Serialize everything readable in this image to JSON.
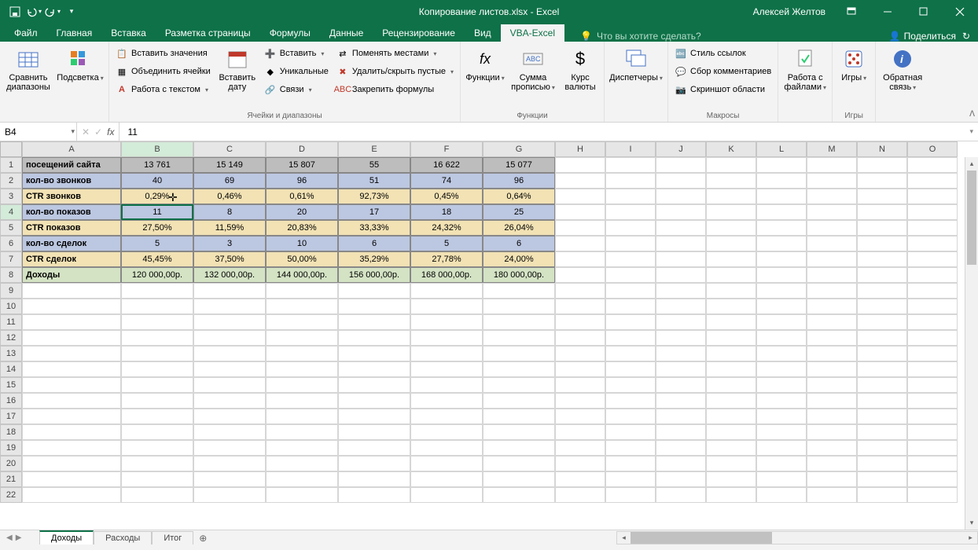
{
  "title": "Копирование листов.xlsx - Excel",
  "user": "Алексей Желтов",
  "tabs": [
    "Файл",
    "Главная",
    "Вставка",
    "Разметка страницы",
    "Формулы",
    "Данные",
    "Рецензирование",
    "Вид",
    "VBA-Excel"
  ],
  "active_tab": "VBA-Excel",
  "tellme": "Что вы хотите сделать?",
  "share": "Поделиться",
  "ribbon": {
    "g1_label": "",
    "compare": "Сравнить диапазоны",
    "highlight": "Подсветка",
    "g2_label": "Ячейки и диапазоны",
    "paste_values": "Вставить значения",
    "merge_cells": "Объединить ячейки",
    "text_work": "Работа с текстом",
    "insert_date": "Вставить дату",
    "insert_menu": "Вставить",
    "unique": "Уникальные",
    "links": "Связи",
    "swap": "Поменять местами",
    "del_hide": "Удалить/скрыть пустые",
    "freeze": "Закрепить формулы",
    "g3_label": "Функции",
    "functions": "Функции",
    "sum_text": "Сумма прописью",
    "currency": "Курс валюты",
    "g4_label": "",
    "dispatchers": "Диспетчеры",
    "g5_label": "Макросы",
    "link_style": "Стиль ссылок",
    "collect_comments": "Сбор комментариев",
    "screenshot": "Скриншот области",
    "g6_label": "",
    "work_files": "Работа с файлами",
    "g7_label": "Игры",
    "games": "Игры",
    "g8_label": "",
    "feedback": "Обратная связь"
  },
  "namebox": "B4",
  "formula_value": "11",
  "columns": [
    "A",
    "B",
    "C",
    "D",
    "E",
    "F",
    "G",
    "H",
    "I",
    "J",
    "K",
    "L",
    "M",
    "N",
    "O"
  ],
  "rows": [
    "1",
    "2",
    "3",
    "4",
    "5",
    "6",
    "7",
    "8",
    "9",
    "10",
    "11",
    "12",
    "13",
    "14",
    "15",
    "16",
    "17",
    "18",
    "19",
    "20",
    "21",
    "22"
  ],
  "data": {
    "r1": {
      "a": "посещений сайта",
      "b": "13 761",
      "c": "15 149",
      "d": "15 807",
      "e": "55",
      "f": "16 622",
      "g": "15 077"
    },
    "r2": {
      "a": "кол-во звонков",
      "b": "40",
      "c": "69",
      "d": "96",
      "e": "51",
      "f": "74",
      "g": "96"
    },
    "r3": {
      "a": "CTR звонков",
      "b": "0,29%",
      "c": "0,46%",
      "d": "0,61%",
      "e": "92,73%",
      "f": "0,45%",
      "g": "0,64%"
    },
    "r4": {
      "a": "кол-во показов",
      "b": "11",
      "c": "8",
      "d": "20",
      "e": "17",
      "f": "18",
      "g": "25"
    },
    "r5": {
      "a": "CTR показов",
      "b": "27,50%",
      "c": "11,59%",
      "d": "20,83%",
      "e": "33,33%",
      "f": "24,32%",
      "g": "26,04%"
    },
    "r6": {
      "a": "кол-во сделок",
      "b": "5",
      "c": "3",
      "d": "10",
      "e": "6",
      "f": "5",
      "g": "6"
    },
    "r7": {
      "a": "CTR сделок",
      "b": "45,45%",
      "c": "37,50%",
      "d": "50,00%",
      "e": "35,29%",
      "f": "27,78%",
      "g": "24,00%"
    },
    "r8": {
      "a": "Доходы",
      "b": "120 000,00р.",
      "c": "132 000,00р.",
      "d": "144 000,00р.",
      "e": "156 000,00р.",
      "f": "168 000,00р.",
      "g": "180 000,00р."
    }
  },
  "selected_cell": "B4",
  "sheets": [
    "Доходы",
    "Расходы",
    "Итог"
  ],
  "active_sheet": "Доходы"
}
